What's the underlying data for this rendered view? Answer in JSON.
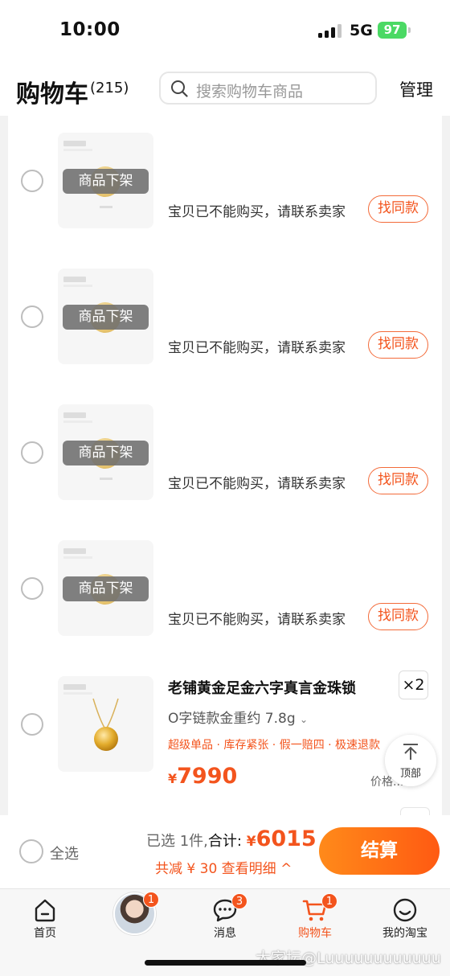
{
  "status_bar": {
    "time": "10:00",
    "network": "5G",
    "battery": "97"
  },
  "header": {
    "title": "购物车",
    "count": "(215)",
    "search_placeholder": "搜索购物车商品",
    "manage_label": "管理"
  },
  "removed_items": [
    {
      "badge": "商品下架",
      "message": "宝贝已不能购买，请联系卖家",
      "action": "找同款"
    },
    {
      "badge": "商品下架",
      "message": "宝贝已不能购买，请联系卖家",
      "action": "找同款"
    },
    {
      "badge": "商品下架",
      "message": "宝贝已不能购买，请联系卖家",
      "action": "找同款"
    },
    {
      "badge": "商品下架",
      "message": "宝贝已不能购买，请联系卖家",
      "action": "找同款"
    }
  ],
  "product": {
    "name": "老铺黄金足金六字真言金珠锁",
    "quantity": "×2",
    "sku": "O字链款金重约 7.8g",
    "tags": "超级单品 · 库存紧张 · 假一赔四 · 极速退款",
    "price_symbol": "¥",
    "price": "7990",
    "price_note": "价格..."
  },
  "back_to_top": "顶部",
  "checkout_bar": {
    "select_all": "全选",
    "selected_text": "已选 1件,",
    "total_label": "合计:",
    "total_symbol": "¥",
    "total_value": "6015",
    "discount": "共减 ¥ 30  查看明细 ^",
    "checkout_label": "结算"
  },
  "tabs": [
    {
      "label": "首页",
      "icon": "home-icon",
      "badge": ""
    },
    {
      "label": "",
      "icon": "avatar",
      "badge": "1"
    },
    {
      "label": "消息",
      "icon": "message-icon",
      "badge": "3"
    },
    {
      "label": "购物车",
      "icon": "cart-icon",
      "badge": "1"
    },
    {
      "label": "我的淘宝",
      "icon": "smile-icon",
      "badge": ""
    }
  ],
  "watermark": "大家坛@Luuuuuuuuuuuu",
  "colors": {
    "accent": "#f3541d",
    "checkout_gradient_start": "#ff8a1a",
    "checkout_gradient_end": "#ff5a12"
  }
}
